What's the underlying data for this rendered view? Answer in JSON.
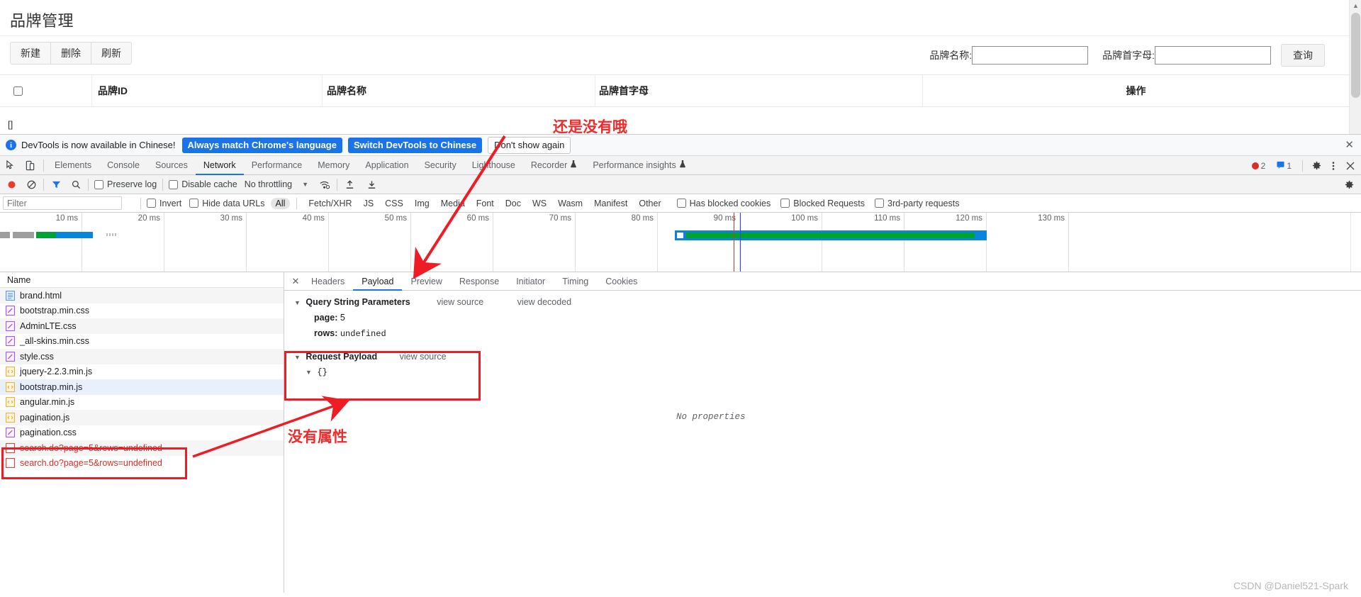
{
  "page": {
    "title": "品牌管理",
    "buttons": [
      {
        "label": "新建",
        "name": "new-button"
      },
      {
        "label": "删除",
        "name": "delete-button"
      },
      {
        "label": "刷新",
        "name": "refresh-button"
      }
    ],
    "search": {
      "name_label": "品牌名称:",
      "name_value": "",
      "initial_label": "品牌首字母:",
      "initial_value": "",
      "query_label": "查询"
    },
    "grid": {
      "columns": [
        "品牌ID",
        "品牌名称",
        "品牌首字母",
        "操作"
      ],
      "empty_text": "[]"
    }
  },
  "devtools": {
    "banner": {
      "message": "DevTools is now available in Chinese!",
      "always_match": "Always match Chrome's language",
      "switch": "Switch DevTools to Chinese",
      "dismiss": "Don't show again",
      "close": "✕"
    },
    "tabs": [
      {
        "label": "Elements",
        "active": false
      },
      {
        "label": "Console",
        "active": false
      },
      {
        "label": "Sources",
        "active": false
      },
      {
        "label": "Network",
        "active": true
      },
      {
        "label": "Performance",
        "active": false
      },
      {
        "label": "Memory",
        "active": false
      },
      {
        "label": "Application",
        "active": false
      },
      {
        "label": "Security",
        "active": false
      },
      {
        "label": "Lighthouse",
        "active": false
      },
      {
        "label": "Recorder",
        "active": false,
        "flask": true
      },
      {
        "label": "Performance insights",
        "active": false,
        "flask": true
      }
    ],
    "status": {
      "error_count": "2",
      "warning_count": "1"
    },
    "network_bar": {
      "preserve_log": "Preserve log",
      "disable_cache": "Disable cache",
      "throttling": "No throttling"
    },
    "filter_bar": {
      "filter_placeholder": "Filter",
      "filter_value": "",
      "invert": "Invert",
      "hide_data_urls": "Hide data URLs",
      "types": [
        "All",
        "Fetch/XHR",
        "JS",
        "CSS",
        "Img",
        "Media",
        "Font",
        "Doc",
        "WS",
        "Wasm",
        "Manifest",
        "Other"
      ],
      "selected_type": "All",
      "has_blocked_cookies": "Has blocked cookies",
      "blocked_requests": "Blocked Requests",
      "third_party": "3rd-party requests"
    },
    "overview": {
      "ticks": [
        "10 ms",
        "20 ms",
        "30 ms",
        "40 ms",
        "50 ms",
        "60 ms",
        "70 ms",
        "80 ms",
        "90 ms",
        "100 ms",
        "110 ms",
        "120 ms",
        "130 ms"
      ]
    },
    "requests": {
      "header": "Name",
      "rows": [
        {
          "name": "brand.html",
          "kind": "doc",
          "state": "odd"
        },
        {
          "name": "bootstrap.min.css",
          "kind": "css",
          "state": "even"
        },
        {
          "name": "AdminLTE.css",
          "kind": "css",
          "state": "odd"
        },
        {
          "name": "_all-skins.min.css",
          "kind": "css",
          "state": "even"
        },
        {
          "name": "style.css",
          "kind": "css",
          "state": "odd"
        },
        {
          "name": "jquery-2.2.3.min.js",
          "kind": "js",
          "state": "even"
        },
        {
          "name": "bootstrap.min.js",
          "kind": "js",
          "state": "sel"
        },
        {
          "name": "angular.min.js",
          "kind": "js",
          "state": "even"
        },
        {
          "name": "pagination.js",
          "kind": "js",
          "state": "odd"
        },
        {
          "name": "pagination.css",
          "kind": "css",
          "state": "even"
        },
        {
          "name": "search.do?page=5&rows=undefined",
          "kind": "xhr",
          "state": "odd",
          "error": true
        },
        {
          "name": "search.do?page=5&rows=undefined",
          "kind": "xhr",
          "state": "even",
          "error": true
        }
      ]
    },
    "detail": {
      "tabs": [
        "Headers",
        "Payload",
        "Preview",
        "Response",
        "Initiator",
        "Timing",
        "Cookies"
      ],
      "active_tab": "Payload",
      "query_section": {
        "title": "Query String Parameters",
        "view_source": "view source",
        "view_decoded": "view decoded",
        "params": [
          {
            "key": "page",
            "value": "5",
            "mono": false
          },
          {
            "key": "rows",
            "value": "undefined",
            "mono": true
          }
        ]
      },
      "payload_section": {
        "title": "Request Payload",
        "view_source": "view source",
        "body": "{}",
        "no_properties": "No properties"
      }
    }
  },
  "annotations": {
    "top_note": "还是没有哦",
    "bottom_note": "没有属性",
    "watermark": "CSDN @Daniel521-Spark"
  },
  "colors": {
    "accent_blue": "#1a73e8",
    "annotation_red": "#ee1c25",
    "error_red": "#d93025",
    "waterfall_green": "#00a234",
    "waterfall_blue": "#0b84de"
  }
}
